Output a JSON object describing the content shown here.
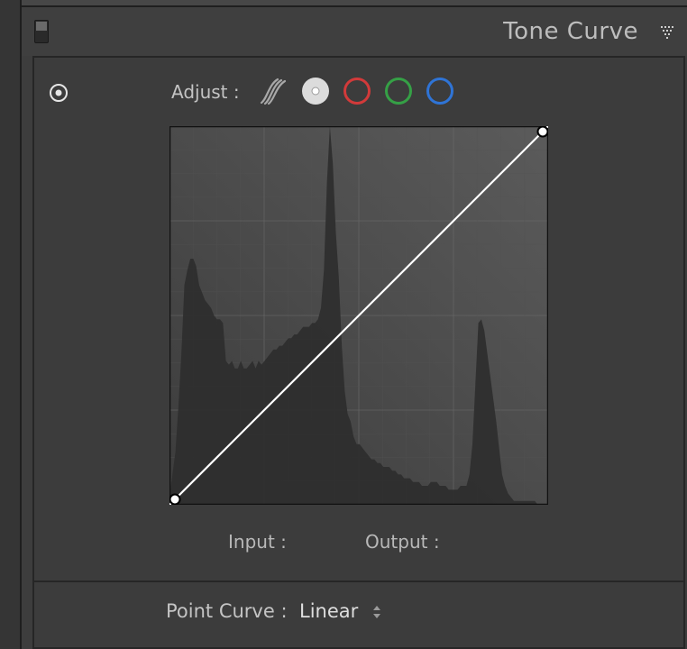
{
  "panel": {
    "title": "Tone Curve"
  },
  "adjust": {
    "label": "Adjust :",
    "channels": [
      {
        "name": "parametric-curve",
        "color": "#9a9a9a"
      },
      {
        "name": "point-curve-rgb",
        "color": "#d9d9d9"
      },
      {
        "name": "red-channel",
        "color": "#d23a3a"
      },
      {
        "name": "green-channel",
        "color": "#35a046"
      },
      {
        "name": "blue-channel",
        "color": "#2f74d6"
      }
    ]
  },
  "curve": {
    "type": "linear",
    "points": [
      [
        0,
        0
      ],
      [
        255,
        255
      ]
    ],
    "histogram": {
      "x": [
        0,
        2,
        4,
        6,
        8,
        10,
        12,
        14,
        16,
        18,
        20,
        22,
        24,
        26,
        28,
        30,
        32,
        34,
        36,
        38,
        40,
        42,
        44,
        46,
        48,
        50,
        52,
        54,
        56,
        58,
        60,
        62,
        64,
        66,
        68,
        70,
        72,
        74,
        76,
        78,
        80,
        82,
        84,
        86,
        88,
        90,
        92,
        94,
        96,
        98,
        100,
        102,
        104,
        106,
        108,
        110,
        112,
        114,
        116,
        118,
        120,
        122,
        124,
        126,
        128,
        130,
        132,
        134,
        136,
        138,
        140,
        142,
        144,
        146,
        148,
        150,
        152,
        154,
        156,
        158,
        160,
        162,
        164,
        166,
        168,
        170,
        172,
        174,
        176,
        178,
        180,
        182,
        184,
        186,
        188,
        190,
        192,
        194,
        196,
        198,
        200,
        202,
        204,
        206,
        208,
        210,
        212,
        214,
        216,
        218,
        220,
        222,
        224,
        226,
        228,
        230,
        232,
        234,
        236,
        238,
        240,
        242,
        244,
        246,
        248,
        250,
        252,
        254
      ],
      "y": [
        2,
        8,
        14,
        26,
        40,
        58,
        62,
        65,
        65,
        63,
        58,
        56,
        54,
        53,
        52,
        50,
        49,
        49,
        48,
        38,
        37,
        38,
        36,
        36,
        38,
        36,
        36,
        37,
        38,
        36,
        38,
        37,
        38,
        39,
        40,
        41,
        41,
        42,
        42,
        43,
        44,
        44,
        45,
        45,
        46,
        47,
        47,
        47,
        48,
        48,
        49,
        52,
        62,
        85,
        100,
        90,
        72,
        60,
        42,
        30,
        24,
        22,
        18,
        16,
        16,
        15,
        14,
        13,
        12,
        12,
        11,
        11,
        10,
        10,
        10,
        9,
        9,
        8,
        8,
        7,
        7,
        7,
        6,
        6,
        6,
        5,
        5,
        5,
        6,
        6,
        6,
        5,
        5,
        5,
        4,
        4,
        4,
        4,
        5,
        5,
        5,
        8,
        16,
        32,
        48,
        49,
        46,
        40,
        34,
        28,
        22,
        15,
        8,
        5,
        3,
        2,
        1,
        1,
        1,
        1,
        1,
        1,
        1,
        1,
        0,
        0,
        0,
        0
      ]
    }
  },
  "readout": {
    "input_label": "Input :",
    "output_label": "Output :"
  },
  "point_curve": {
    "label": "Point Curve :",
    "value": "Linear"
  }
}
